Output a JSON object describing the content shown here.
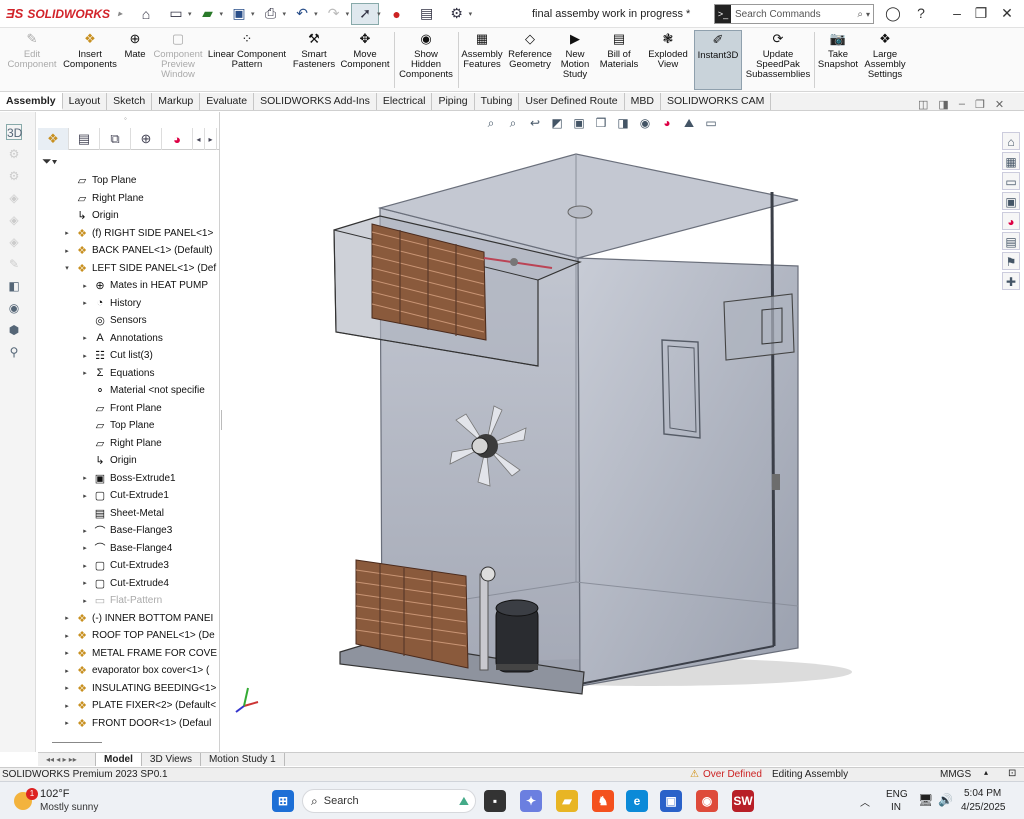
{
  "app": {
    "logo_text": "SOLIDWORKS",
    "document_title": "final assemby work in progress *",
    "search_placeholder": "Search Commands"
  },
  "ribbon": {
    "buttons": [
      {
        "label": "Edit\nComponent",
        "icon": "edit-component-icon",
        "disabled": true
      },
      {
        "label": "Insert\nComponents",
        "icon": "insert-components-icon",
        "disabled": false
      },
      {
        "label": "Mate",
        "icon": "mate-icon",
        "disabled": false
      },
      {
        "label": "Component\nPreview\nWindow",
        "icon": "preview-window-icon",
        "disabled": true
      },
      {
        "label": "Linear Component\nPattern",
        "icon": "linear-pattern-icon",
        "disabled": false
      },
      {
        "label": "Smart\nFasteners",
        "icon": "smart-fasteners-icon",
        "disabled": false
      },
      {
        "label": "Move\nComponent",
        "icon": "move-component-icon",
        "disabled": false
      },
      {
        "label": "Show\nHidden\nComponents",
        "icon": "show-hidden-icon",
        "disabled": false
      },
      {
        "label": "Assembly\nFeatures",
        "icon": "assembly-features-icon",
        "disabled": false
      },
      {
        "label": "Reference\nGeometry",
        "icon": "reference-geometry-icon",
        "disabled": false
      },
      {
        "label": "New\nMotion\nStudy",
        "icon": "motion-study-icon",
        "disabled": false
      },
      {
        "label": "Bill of\nMaterials",
        "icon": "bom-icon",
        "disabled": false
      },
      {
        "label": "Exploded\nView",
        "icon": "exploded-view-icon",
        "disabled": false
      },
      {
        "label": "Instant3D",
        "icon": "instant3d-icon",
        "disabled": false,
        "active": true
      },
      {
        "label": "Update\nSpeedPak\nSubassemblies",
        "icon": "speedpak-icon",
        "disabled": false
      },
      {
        "label": "Take\nSnapshot",
        "icon": "snapshot-icon",
        "disabled": false
      },
      {
        "label": "Large\nAssembly\nSettings",
        "icon": "large-assembly-icon",
        "disabled": false
      }
    ]
  },
  "tabs": [
    "Assembly",
    "Layout",
    "Sketch",
    "Markup",
    "Evaluate",
    "SOLIDWORKS Add-Ins",
    "Electrical",
    "Piping",
    "Tubing",
    "User Defined Route",
    "MBD",
    "SOLIDWORKS CAM"
  ],
  "tree": {
    "rows": [
      {
        "label": "Top Plane",
        "indent": 0,
        "twisty": "",
        "icon": "plane-icon"
      },
      {
        "label": "Right Plane",
        "indent": 0,
        "twisty": "",
        "icon": "plane-icon"
      },
      {
        "label": "Origin",
        "indent": 0,
        "twisty": "",
        "icon": "origin-icon"
      },
      {
        "label": "(f) RIGHT SIDE PANEL<1>",
        "indent": 0,
        "twisty": "▸",
        "icon": "part-icon"
      },
      {
        "label": "BACK PANEL<1> (Default)",
        "indent": 0,
        "twisty": "▸",
        "icon": "part-icon"
      },
      {
        "label": "LEFT SIDE PANEL<1> (Def",
        "indent": 0,
        "twisty": "▾",
        "icon": "part-icon"
      },
      {
        "label": "Mates in HEAT PUMP",
        "indent": 1,
        "twisty": "▸",
        "icon": "mates-icon"
      },
      {
        "label": "History",
        "indent": 1,
        "twisty": "▸",
        "icon": "history-icon"
      },
      {
        "label": "Sensors",
        "indent": 1,
        "twisty": "",
        "icon": "sensors-icon"
      },
      {
        "label": "Annotations",
        "indent": 1,
        "twisty": "▸",
        "icon": "annotations-icon"
      },
      {
        "label": "Cut list(3)",
        "indent": 1,
        "twisty": "▸",
        "icon": "cutlist-icon"
      },
      {
        "label": "Equations",
        "indent": 1,
        "twisty": "▸",
        "icon": "equations-icon"
      },
      {
        "label": "Material <not specifie",
        "indent": 1,
        "twisty": "",
        "icon": "material-icon"
      },
      {
        "label": "Front Plane",
        "indent": 1,
        "twisty": "",
        "icon": "plane-icon"
      },
      {
        "label": "Top Plane",
        "indent": 1,
        "twisty": "",
        "icon": "plane-icon"
      },
      {
        "label": "Right Plane",
        "indent": 1,
        "twisty": "",
        "icon": "plane-icon"
      },
      {
        "label": "Origin",
        "indent": 1,
        "twisty": "",
        "icon": "origin-icon"
      },
      {
        "label": "Boss-Extrude1",
        "indent": 1,
        "twisty": "▸",
        "icon": "extrude-icon"
      },
      {
        "label": "Cut-Extrude1",
        "indent": 1,
        "twisty": "▸",
        "icon": "cut-icon"
      },
      {
        "label": "Sheet-Metal",
        "indent": 1,
        "twisty": "",
        "icon": "sheetmetal-icon"
      },
      {
        "label": "Base-Flange3",
        "indent": 1,
        "twisty": "▸",
        "icon": "flange-icon"
      },
      {
        "label": "Base-Flange4",
        "indent": 1,
        "twisty": "▸",
        "icon": "flange-icon"
      },
      {
        "label": "Cut-Extrude3",
        "indent": 1,
        "twisty": "▸",
        "icon": "cut-icon"
      },
      {
        "label": "Cut-Extrude4",
        "indent": 1,
        "twisty": "▸",
        "icon": "cut-icon"
      },
      {
        "label": "Flat-Pattern",
        "indent": 1,
        "twisty": "▸",
        "icon": "flatpattern-icon",
        "disabled": true
      },
      {
        "label": "(-) INNER BOTTOM PANEI",
        "indent": 0,
        "twisty": "▸",
        "icon": "part-icon"
      },
      {
        "label": "ROOF TOP PANEL<1> (De",
        "indent": 0,
        "twisty": "▸",
        "icon": "part-icon"
      },
      {
        "label": "METAL FRAME FOR COVE",
        "indent": 0,
        "twisty": "▸",
        "icon": "part-icon"
      },
      {
        "label": "evaporator box cover<1> (",
        "indent": 0,
        "twisty": "▸",
        "icon": "part-icon"
      },
      {
        "label": "INSULATING BEEDING<1>",
        "indent": 0,
        "twisty": "▸",
        "icon": "part-icon"
      },
      {
        "label": "PLATE FIXER<2> (Default<",
        "indent": 0,
        "twisty": "▸",
        "icon": "part-icon"
      },
      {
        "label": "FRONT DOOR<1> (Defaul",
        "indent": 0,
        "twisty": "▸",
        "icon": "part-icon"
      }
    ]
  },
  "bottom_tabs": [
    "Model",
    "3D Views",
    "Motion Study 1"
  ],
  "status": {
    "product": "SOLIDWORKS Premium 2023 SP0.1",
    "warning": "Over Defined",
    "mode": "Editing Assembly",
    "units": "MMGS"
  },
  "taskbar": {
    "weather_temp": "102°F",
    "weather_text": "Mostly sunny",
    "weather_badge": "1",
    "search_label": "Search",
    "lang": "ENG",
    "region": "IN",
    "time": "5:04 PM",
    "date": "4/25/2025"
  }
}
